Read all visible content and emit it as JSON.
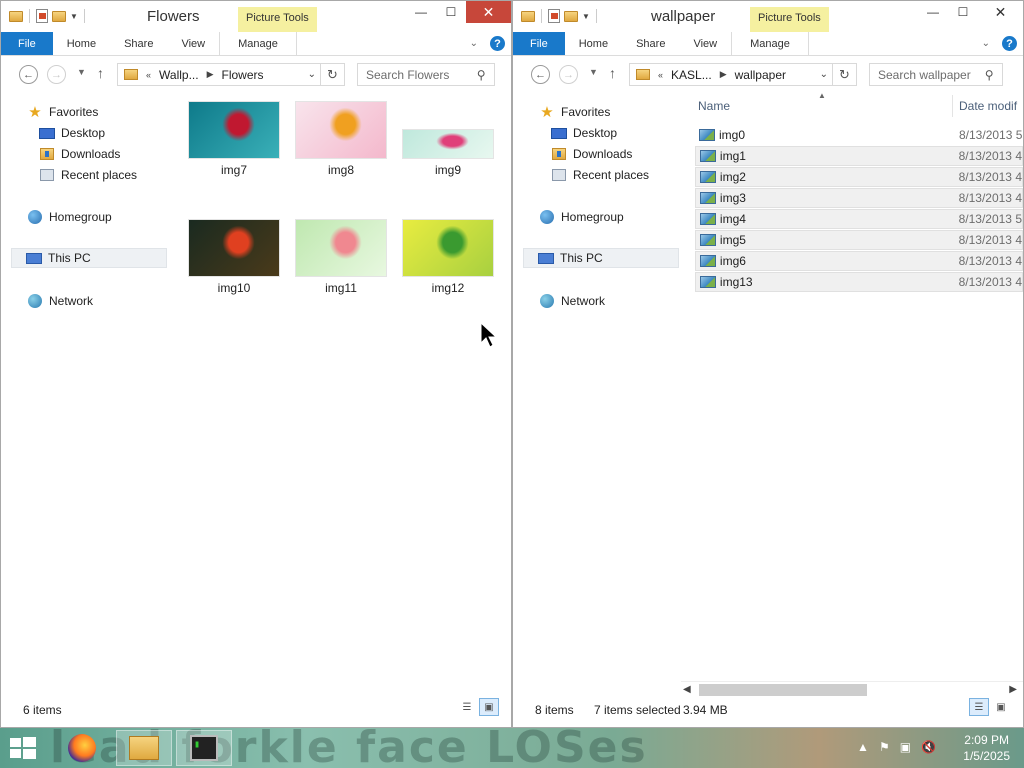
{
  "left": {
    "title": "Flowers",
    "context_tab": "Picture Tools",
    "ribbon_tabs": [
      "File",
      "Home",
      "Share",
      "View",
      "Manage"
    ],
    "path": [
      "Wallp...",
      "Flowers"
    ],
    "search_placeholder": "Search Flowers",
    "nav": {
      "favorites": "Favorites",
      "desktop": "Desktop",
      "downloads": "Downloads",
      "recent": "Recent places",
      "homegroup": "Homegroup",
      "thispc": "This PC",
      "network": "Network"
    },
    "thumbnails": [
      {
        "name": "img7",
        "colors": [
          "#0e7a8a",
          "#3ab0b8",
          "#c01830"
        ]
      },
      {
        "name": "img8",
        "colors": [
          "#f8e4ec",
          "#f4b8cc",
          "#f0a020"
        ]
      },
      {
        "name": "img9",
        "colors": [
          "#bfe8dc",
          "#e8f8f0",
          "#e0407a"
        ]
      },
      {
        "name": "img10",
        "colors": [
          "#1a2a20",
          "#4a3a1a",
          "#e04020"
        ]
      },
      {
        "name": "img11",
        "colors": [
          "#bfe8b0",
          "#e8f8e0",
          "#f08890"
        ]
      },
      {
        "name": "img12",
        "colors": [
          "#e8ec40",
          "#a8d040",
          "#3a9a30"
        ]
      }
    ],
    "status": {
      "count": "6 items"
    }
  },
  "right": {
    "title": "wallpaper",
    "context_tab": "Picture Tools",
    "ribbon_tabs": [
      "File",
      "Home",
      "Share",
      "View",
      "Manage"
    ],
    "path": [
      "KASL...",
      "wallpaper"
    ],
    "search_placeholder": "Search wallpaper",
    "nav": {
      "favorites": "Favorites",
      "desktop": "Desktop",
      "downloads": "Downloads",
      "recent": "Recent places",
      "homegroup": "Homegroup",
      "thispc": "This PC",
      "network": "Network"
    },
    "columns": {
      "name": "Name",
      "date": "Date modif"
    },
    "files": [
      {
        "name": "img0",
        "date": "8/13/2013 5",
        "selected": false
      },
      {
        "name": "img1",
        "date": "8/13/2013 4",
        "selected": true
      },
      {
        "name": "img2",
        "date": "8/13/2013 4",
        "selected": true
      },
      {
        "name": "img3",
        "date": "8/13/2013 4",
        "selected": true
      },
      {
        "name": "img4",
        "date": "8/13/2013 5",
        "selected": true
      },
      {
        "name": "img5",
        "date": "8/13/2013 4",
        "selected": true
      },
      {
        "name": "img6",
        "date": "8/13/2013 4",
        "selected": true
      },
      {
        "name": "img13",
        "date": "8/13/2013 4",
        "selected": true
      }
    ],
    "status": {
      "count": "8 items",
      "selected": "7 items selected",
      "size": "3.94 MB"
    }
  },
  "taskbar": {
    "wallpaper_text": "lead forkle face LOSes",
    "clock_time": "2:09 PM",
    "clock_date": "1/5/2025"
  }
}
